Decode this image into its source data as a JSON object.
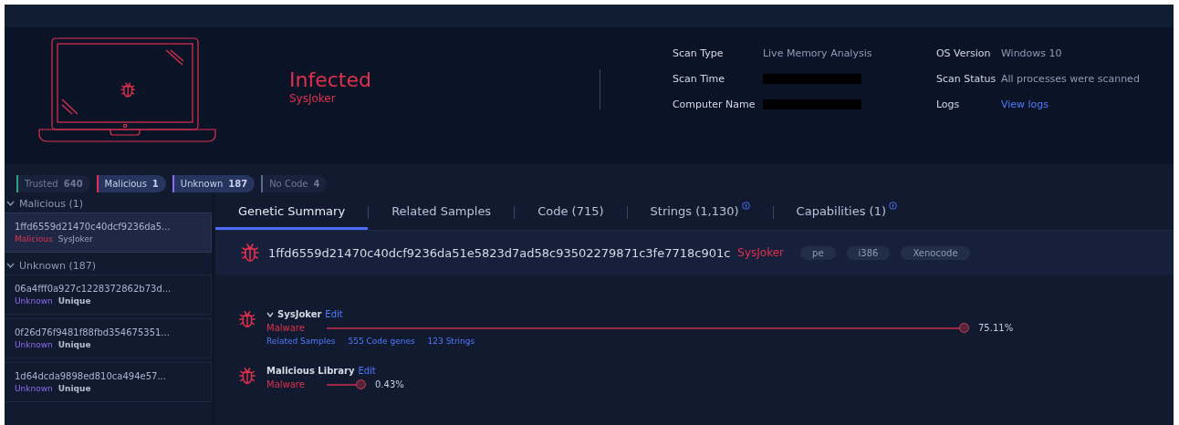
{
  "header": {
    "status": "Infected",
    "family": "SysJoker",
    "info": [
      {
        "label": "Scan Type",
        "value": "Live Memory Analysis",
        "kind": "text"
      },
      {
        "label": "OS Version",
        "value": "Windows 10",
        "kind": "text"
      },
      {
        "label": "Scan Time",
        "kind": "redacted"
      },
      {
        "label": "Scan Status",
        "value": "All processes were scanned",
        "kind": "text"
      },
      {
        "label": "Computer Name",
        "kind": "redacted"
      },
      {
        "label": "Logs",
        "value": "View logs",
        "kind": "link"
      }
    ]
  },
  "filters": [
    {
      "label": "Trusted",
      "count": "640",
      "color": "#2fa37e",
      "selected": false
    },
    {
      "label": "Malicious",
      "count": "1",
      "color": "#e0304e",
      "selected": true
    },
    {
      "label": "Unknown",
      "count": "187",
      "color": "#8a6cf0",
      "selected": true
    },
    {
      "label": "No Code",
      "count": "4",
      "color": "#5a6a8a",
      "selected": false
    }
  ],
  "sidebar": {
    "groups": [
      {
        "title": "Malicious (1)",
        "expanded": true,
        "items": [
          {
            "hash": "1ffd6559d21470c40dcf9236da5...",
            "status": "Malicious",
            "kind": "malicious",
            "tag": "SysJoker",
            "selected": true
          }
        ]
      },
      {
        "title": "Unknown (187)",
        "expanded": true,
        "items": [
          {
            "hash": "06a4fff0a927c1228372862b73d...",
            "status": "Unknown",
            "kind": "unknown",
            "tag": "Unique",
            "selected": false
          },
          {
            "hash": "0f26d76f9481f88fbd354675351...",
            "status": "Unknown",
            "kind": "unknown",
            "tag": "Unique",
            "selected": false
          },
          {
            "hash": "1d64dcda9898ed810ca494e57...",
            "status": "Unknown",
            "kind": "unknown",
            "tag": "Unique",
            "selected": false
          }
        ]
      }
    ]
  },
  "tabs": [
    {
      "label": "Genetic Summary",
      "selected": true,
      "info": false
    },
    {
      "label": "Related Samples",
      "selected": false,
      "info": false
    },
    {
      "label": "Code (715)",
      "selected": false,
      "info": false
    },
    {
      "label": "Strings (1,130)",
      "selected": false,
      "info": true
    },
    {
      "label": "Capabilities (1)",
      "selected": false,
      "info": true
    }
  ],
  "sample": {
    "hash": "1ffd6559d21470c40dcf9236da51e5823d7ad58c93502279871c3fe7718c901c",
    "family": "SysJoker",
    "tags": [
      "pe",
      "i386",
      "Xenocode"
    ]
  },
  "genes": [
    {
      "name": "SysJoker",
      "expanded": true,
      "edit": "Edit",
      "type": "Malware",
      "reading": "75.11%",
      "links": [
        "Related Samples",
        "555 Code genes",
        "123 Strings"
      ]
    },
    {
      "name": "Malicious Library",
      "expanded": false,
      "edit": "Edit",
      "type": "Malware",
      "reading": "0.43%"
    }
  ]
}
